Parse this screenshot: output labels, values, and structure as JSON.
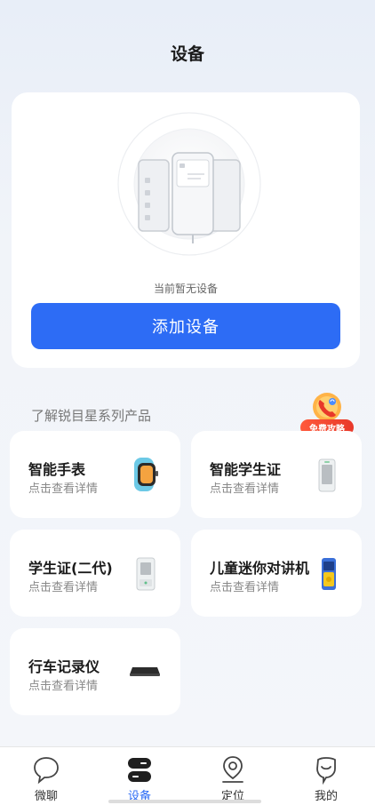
{
  "header": {
    "title": "设备"
  },
  "device_card": {
    "empty_text": "当前暂无设备",
    "add_button_label": "添加设备"
  },
  "products_section": {
    "title": "了解锐目星系列产品",
    "promo_badge": "免费攻略"
  },
  "products": [
    {
      "name": "智能手表",
      "desc": "点击查看详情",
      "icon": "smartwatch-icon"
    },
    {
      "name": "智能学生证",
      "desc": "点击查看详情",
      "icon": "student-card-icon"
    },
    {
      "name": "学生证(二代)",
      "desc": "点击查看详情",
      "icon": "student-card-gen2-icon"
    },
    {
      "name": "儿童迷你对讲机",
      "desc": "点击查看详情",
      "icon": "walkie-talkie-icon"
    },
    {
      "name": "行车记录仪",
      "desc": "点击查看详情",
      "icon": "dashcam-icon"
    }
  ],
  "tabbar": [
    {
      "label": "微聊",
      "icon": "chat-bubble-icon",
      "active": false
    },
    {
      "label": "设备",
      "icon": "device-icon",
      "active": true
    },
    {
      "label": "定位",
      "icon": "location-pin-icon",
      "active": false
    },
    {
      "label": "我的",
      "icon": "profile-icon",
      "active": false
    }
  ],
  "colors": {
    "accent": "#2d6cf5",
    "promo": "#e8382a",
    "background": "#eef2f8"
  }
}
